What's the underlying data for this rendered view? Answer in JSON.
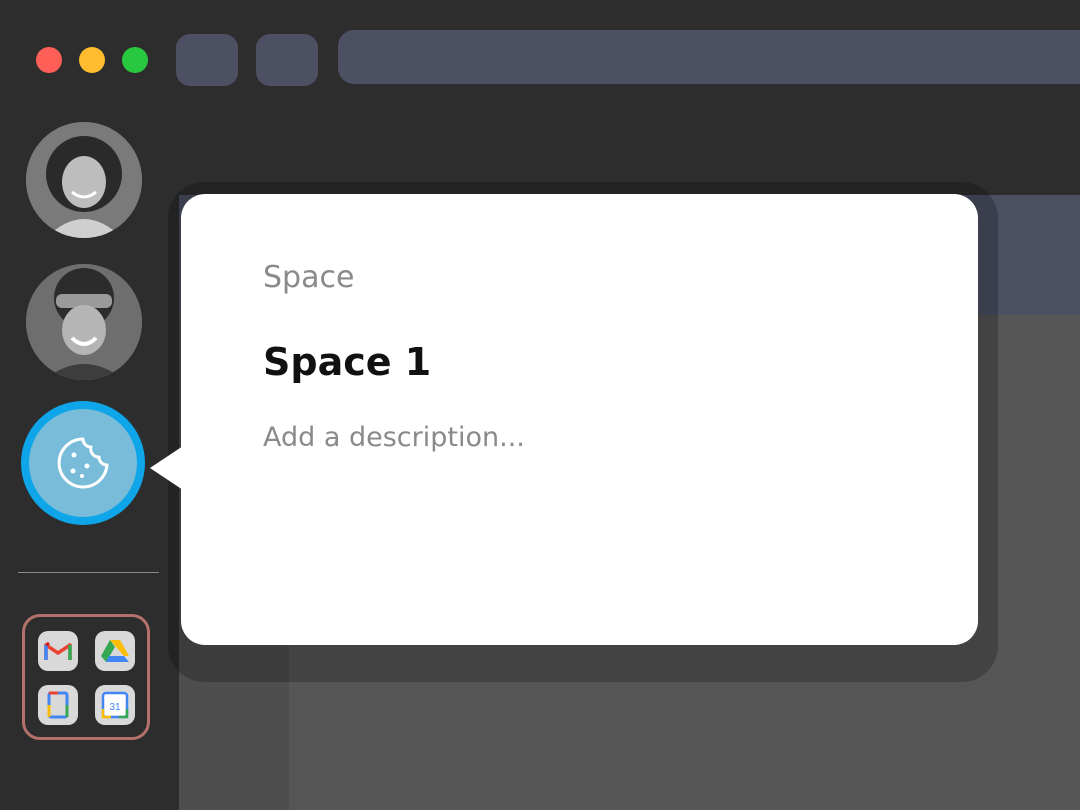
{
  "window": {
    "traffic_lights": {
      "close": "#ff5f57",
      "minimize": "#febc2e",
      "zoom": "#28c840"
    }
  },
  "sidebar": {
    "avatars": [
      {
        "name": "avatar-user-1"
      },
      {
        "name": "avatar-user-2"
      }
    ],
    "active_space_icon": "cookie-icon",
    "apps": [
      {
        "icon": "gmail-icon"
      },
      {
        "icon": "google-drive-icon"
      },
      {
        "icon": "google-docs-icon"
      },
      {
        "icon": "google-calendar-icon",
        "label": "31"
      }
    ]
  },
  "popover": {
    "label": "Space",
    "title": "Space 1",
    "description_placeholder": "Add a description..."
  },
  "colors": {
    "accent": "#0ea5e9",
    "space_fill": "#79bcd9",
    "folder_border": "#b4716c"
  }
}
